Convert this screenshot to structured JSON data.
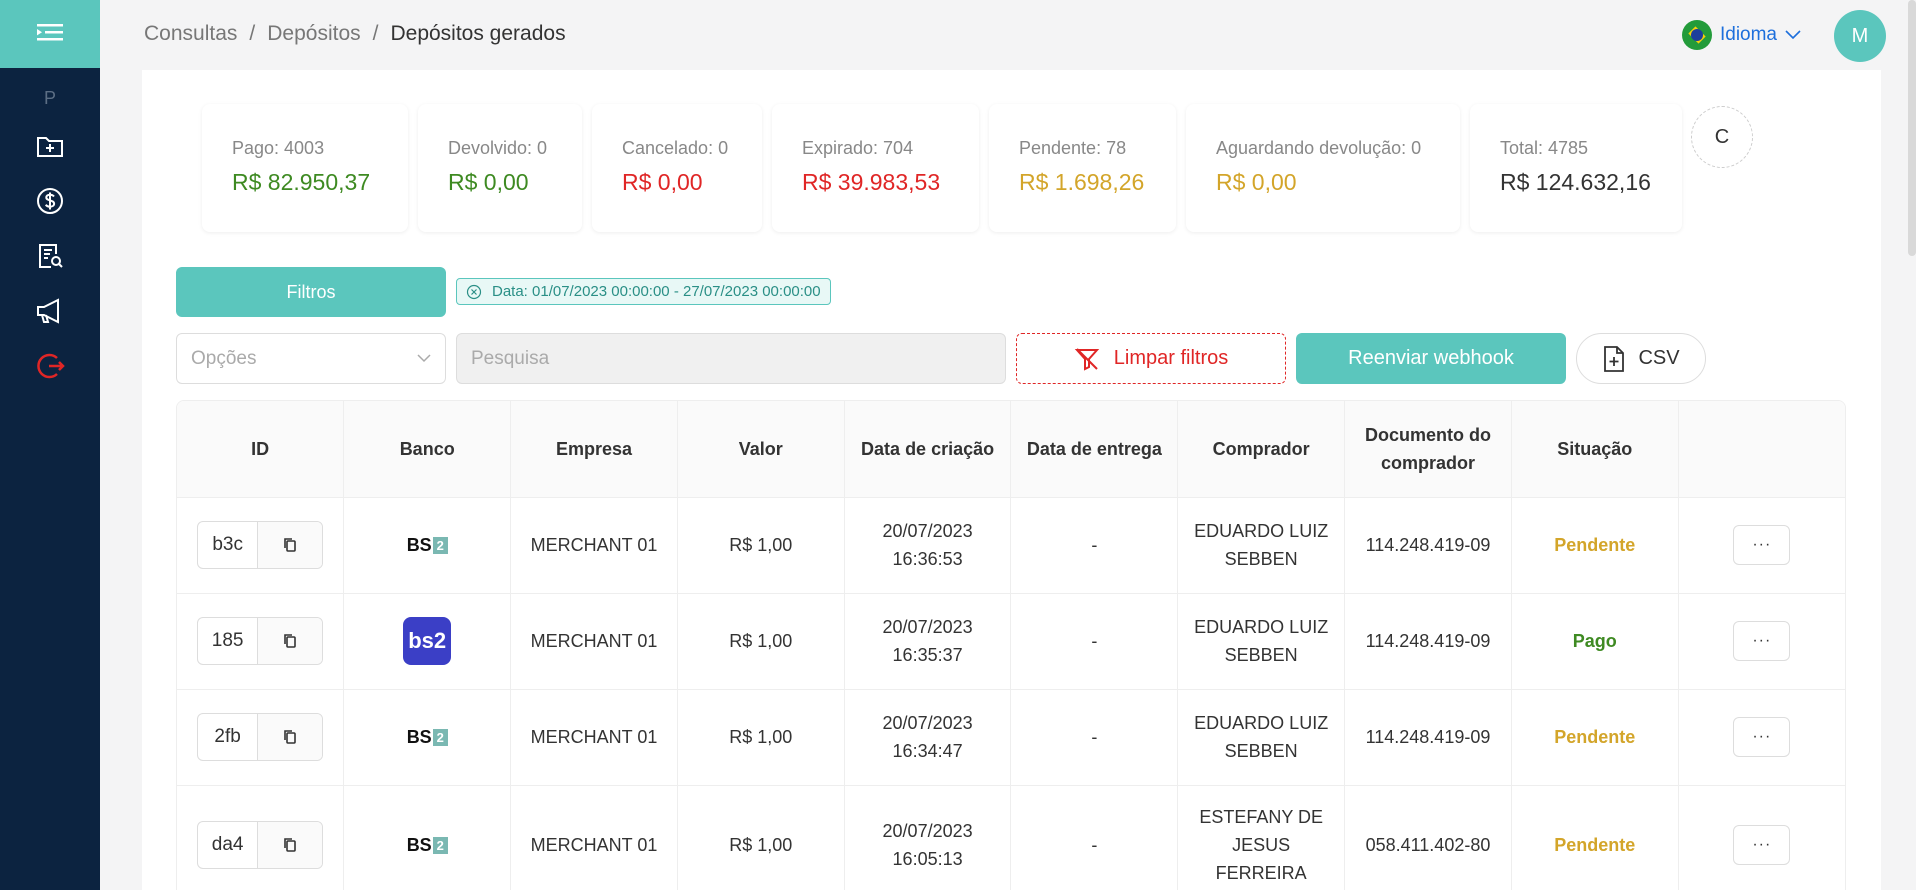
{
  "sidebar": {
    "letter": "P",
    "items": [
      {
        "icon": "folder-plus-icon"
      },
      {
        "icon": "dollar-icon"
      },
      {
        "icon": "report-search-icon"
      },
      {
        "icon": "megaphone-icon"
      },
      {
        "icon": "logout-icon"
      }
    ]
  },
  "header": {
    "breadcrumb": [
      "Consultas",
      "/",
      "Depósitos",
      "/",
      "Depósitos gerados"
    ],
    "language_label": "Idioma",
    "avatar_initial": "M"
  },
  "stats": [
    {
      "label": "Pago: 4003",
      "value": "R$ 82.950,37",
      "color": "#3e8a22"
    },
    {
      "label": "Devolvido: 0",
      "value": "R$ 0,00",
      "color": "#3e8a22"
    },
    {
      "label": "Cancelado: 0",
      "value": "R$ 0,00",
      "color": "#e02626"
    },
    {
      "label": "Expirado: 704",
      "value": "R$ 39.983,53",
      "color": "#e02626"
    },
    {
      "label": "Pendente: 78",
      "value": "R$ 1.698,26",
      "color": "#d3a52a"
    },
    {
      "label": "Aguardando devolução: 0",
      "value": "R$ 0,00",
      "color": "#d3a52a"
    },
    {
      "label": "Total: 4785",
      "value": "R$ 124.632,16",
      "color": "#333333"
    }
  ],
  "refresh_symbol": "C",
  "filters": {
    "button_label": "Filtros",
    "date_tag": "Data: 01/07/2023 00:00:00 - 27/07/2023 00:00:00",
    "options_placeholder": "Opções",
    "search_placeholder": "Pesquisa",
    "clear_label": "Limpar filtros",
    "webhook_label": "Reenviar webhook",
    "csv_label": "CSV"
  },
  "table": {
    "headers": [
      "ID",
      "Banco",
      "Empresa",
      "Valor",
      "Data de criação",
      "Data de entrega",
      "Comprador",
      "Documento do comprador",
      "Situação",
      ""
    ],
    "rows": [
      {
        "id": "b3c",
        "bank": "BS2",
        "bank_logo": "small",
        "company": "MERCHANT 01",
        "value": "R$ 1,00",
        "created": "20/07/2023 16:36:53",
        "delivered": "-",
        "buyer": "EDUARDO LUIZ SEBBEN",
        "document": "114.248.419-09",
        "status": "Pendente",
        "action": "···"
      },
      {
        "id": "185",
        "bank": "bs2",
        "bank_logo": "big",
        "company": "MERCHANT 01",
        "value": "R$ 1,00",
        "created": "20/07/2023 16:35:37",
        "delivered": "-",
        "buyer": "EDUARDO LUIZ SEBBEN",
        "document": "114.248.419-09",
        "status": "Pago",
        "action": "···"
      },
      {
        "id": "2fb",
        "bank": "BS2",
        "bank_logo": "small",
        "company": "MERCHANT 01",
        "value": "R$ 1,00",
        "created": "20/07/2023 16:34:47",
        "delivered": "-",
        "buyer": "EDUARDO LUIZ SEBBEN",
        "document": "114.248.419-09",
        "status": "Pendente",
        "action": "···"
      },
      {
        "id": "da4",
        "bank": "BS2",
        "bank_logo": "small",
        "company": "MERCHANT 01",
        "value": "R$ 1,00",
        "created": "20/07/2023 16:05:13",
        "delivered": "-",
        "buyer": "ESTEFANY DE JESUS FERREIRA",
        "document": "058.411.402-80",
        "status": "Pendente",
        "action": "···"
      }
    ]
  },
  "colors": {
    "accent": "#5bc6bd",
    "sidebar": "#0c2340",
    "paid": "#3e8a22",
    "pending": "#d3a52a",
    "danger": "#e02626"
  }
}
